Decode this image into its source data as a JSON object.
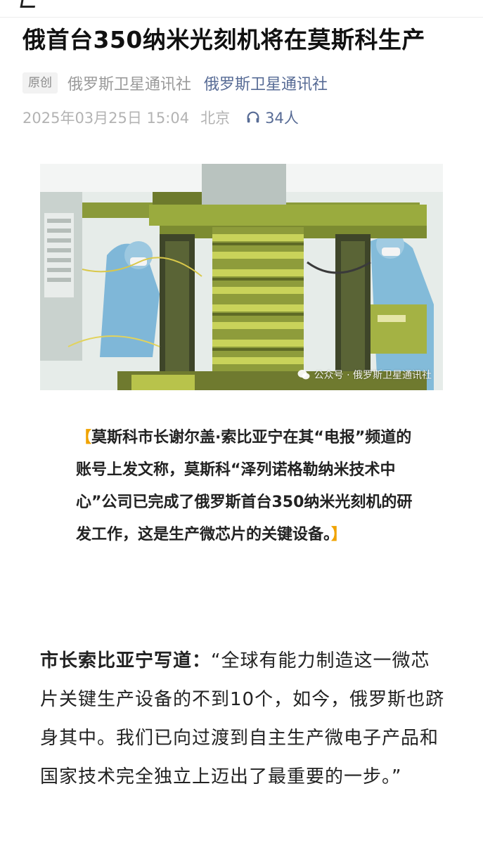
{
  "article": {
    "title": "俄首台350纳米光刻机将在莫斯科生产",
    "badge": "原创",
    "author": "俄罗斯卫星通讯社",
    "account": "俄罗斯卫星通讯社",
    "date": "2025年03月25日 15:04",
    "location": "北京",
    "listeners": "34人",
    "image": {
      "watermark": "公众号 · 俄罗斯卫星通讯社"
    },
    "quote": {
      "open_bracket": "【",
      "text": "莫斯科市长谢尔盖·索比亚宁在其“电报”频道的账号上发文称，莫斯科“泽列诺格勒纳米技术中心”公司已完成了俄罗斯首台350纳米光刻机的研发工作，这是生产微芯片的关键设备。",
      "close_bracket": "】"
    },
    "paragraph": {
      "lead": "市长索比亚宁写道：",
      "text": "“全球有能力制造这一微芯片关键生产设备的不到10个，如今，俄罗斯也跻身其中。我们已向过渡到自主生产微电子产品和国家技术完全独立上迈出了最重要的一步。”"
    }
  },
  "colors": {
    "accent_link": "#576b95",
    "bracket": "#f0a300",
    "meta_gray": "#b3b3b3"
  },
  "icons": {
    "listen": "headphones-icon",
    "watermark": "wechat-icon"
  }
}
